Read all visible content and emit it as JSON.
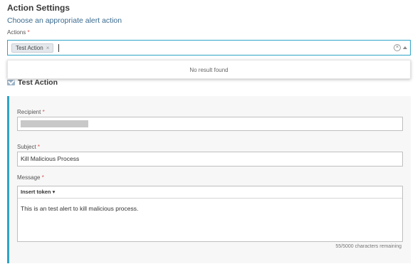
{
  "section": {
    "title": "Action Settings",
    "subtitle": "Choose an appropriate alert action"
  },
  "actions": {
    "label": "Actions",
    "required_mark": "*",
    "selected_tag": "Test Action",
    "tag_remove": "×",
    "clear_symbol": "×",
    "dropdown_message": "No result found"
  },
  "test_action": {
    "heading": "Test Action",
    "recipient": {
      "label": "Recipient",
      "required_mark": "*"
    },
    "subject": {
      "label": "Subject",
      "required_mark": "*",
      "value": "Kill Malicious Process"
    },
    "message": {
      "label": "Message",
      "required_mark": "*",
      "toolbar_label": "Insert token",
      "toolbar_arrow": "▾",
      "value": "This is an test alert to kill malicious process.",
      "remaining": "55/5000 characters remaining"
    }
  },
  "colors": {
    "accent": "#2fa4c7",
    "subtitle": "#3b6b8f",
    "required": "#d9534f"
  }
}
